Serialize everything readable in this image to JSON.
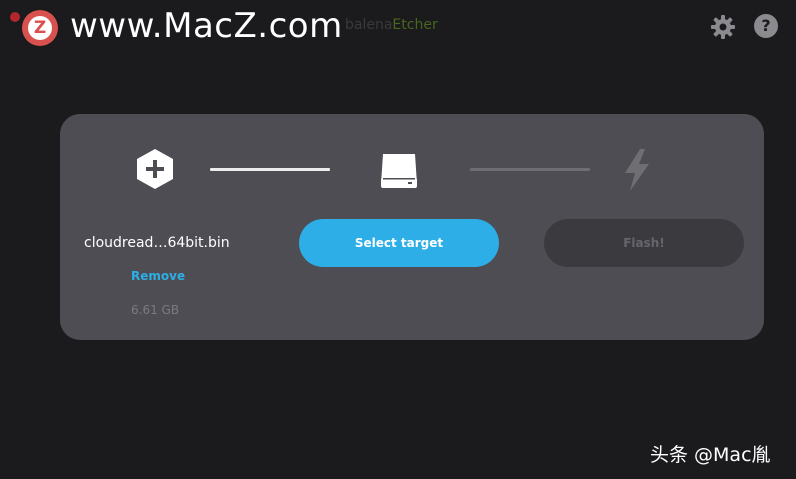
{
  "watermark": {
    "badge_letter": "Z",
    "site": "www.MacZ.com",
    "credit": "头条 @Mac胤"
  },
  "app": {
    "brand_part1": "balena",
    "brand_part2": "Etcher"
  },
  "header": {
    "settings_icon": "gear-icon",
    "help_icon": "help-icon",
    "help_glyph": "?"
  },
  "steps": {
    "image": {
      "icon": "plus-hexagon-icon",
      "file_name": "cloudread…64bit.bin",
      "remove_label": "Remove",
      "size": "6.61 GB"
    },
    "target": {
      "icon": "drive-icon",
      "button_label": "Select target"
    },
    "flash": {
      "icon": "lightning-icon",
      "button_label": "Flash!"
    }
  },
  "colors": {
    "background": "#1b1b1e",
    "panel": "#4d4d53",
    "accent": "#2eaee6",
    "disabled_button": "#3a3a3f"
  }
}
